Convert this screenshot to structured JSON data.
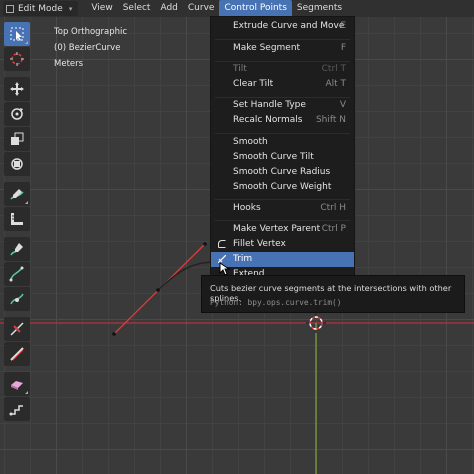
{
  "header": {
    "mode": "Edit Mode",
    "menus": [
      {
        "label": "View"
      },
      {
        "label": "Select"
      },
      {
        "label": "Add"
      },
      {
        "label": "Curve"
      },
      {
        "label": "Control Points",
        "active": true
      },
      {
        "label": "Segments"
      }
    ]
  },
  "overlay": {
    "view_name": "Top Orthographic",
    "object_name": "(0) BezierCurve",
    "units": "Meters"
  },
  "toolbar": {
    "tools": [
      "select-box",
      "cursor",
      "move",
      "rotate",
      "scale",
      "transform",
      "annotate",
      "measure",
      "draw",
      "pen",
      "tilt",
      "radius",
      "randomize",
      "extrude-cursor",
      "shear"
    ]
  },
  "menu": {
    "items": [
      {
        "label": "Extrude Curve and Move",
        "shortcut": "E"
      },
      {
        "label": "Make Segment",
        "shortcut": "F"
      },
      {
        "label": "Tilt",
        "shortcut": "Ctrl T",
        "disabled": true
      },
      {
        "label": "Clear Tilt",
        "shortcut": "Alt T"
      },
      {
        "label": "Set Handle Type",
        "shortcut": "V"
      },
      {
        "label": "Recalc Normals",
        "shortcut": "Shift N"
      },
      {
        "label": "Smooth",
        "shortcut": ""
      },
      {
        "label": "Smooth Curve Tilt",
        "shortcut": ""
      },
      {
        "label": "Smooth Curve Radius",
        "shortcut": ""
      },
      {
        "label": "Smooth Curve Weight",
        "shortcut": ""
      },
      {
        "label": "Hooks",
        "shortcut": "Ctrl H"
      },
      {
        "label": "Make Vertex Parent",
        "shortcut": "Ctrl P"
      },
      {
        "label": "Fillet Vertex",
        "shortcut": "",
        "icon": "fillet-icon"
      },
      {
        "label": "Trim",
        "shortcut": "",
        "icon": "trim-icon",
        "highlighted": true
      },
      {
        "label": "Extend",
        "shortcut": ""
      }
    ]
  },
  "tooltip": {
    "description": "Cuts bezier curve segments at the intersections with other splines.",
    "python": "Python: bpy.ops.curve.trim()"
  },
  "colors": {
    "x_axis": "#b8323c",
    "y_axis": "#7ea33a",
    "highlight": "#4772b3",
    "curve_selected": "#e23a3a"
  }
}
